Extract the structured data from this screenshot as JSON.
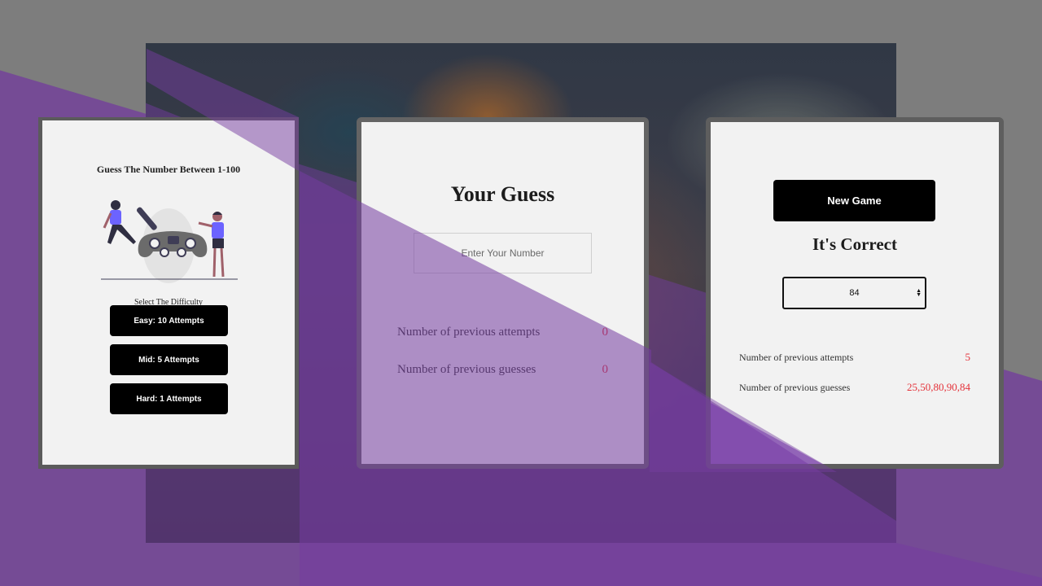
{
  "left_panel": {
    "title": "Guess The Number Between 1-100",
    "difficulty_label": "Select The Difficulty",
    "buttons": {
      "easy": "Easy: 10 Attempts",
      "mid": "Mid: 5 Attempts",
      "hard": "Hard: 1 Attempts"
    }
  },
  "middle_panel": {
    "title": "Your Guess",
    "input_placeholder": "Enter Your Number",
    "attempts_label": "Number of previous attempts",
    "attempts_value": "0",
    "guesses_label": "Number of previous guesses",
    "guesses_value": "0"
  },
  "right_panel": {
    "new_game_label": "New Game",
    "result_title": "It's Correct",
    "number_value": "84",
    "attempts_label": "Number of previous attempts",
    "attempts_value": "5",
    "guesses_label": "Number of previous guesses",
    "guesses_value": "25,50,80,90,84"
  },
  "colors": {
    "accent_purple": "#754b95",
    "value_red": "#e4323a",
    "button_black": "#000000"
  }
}
